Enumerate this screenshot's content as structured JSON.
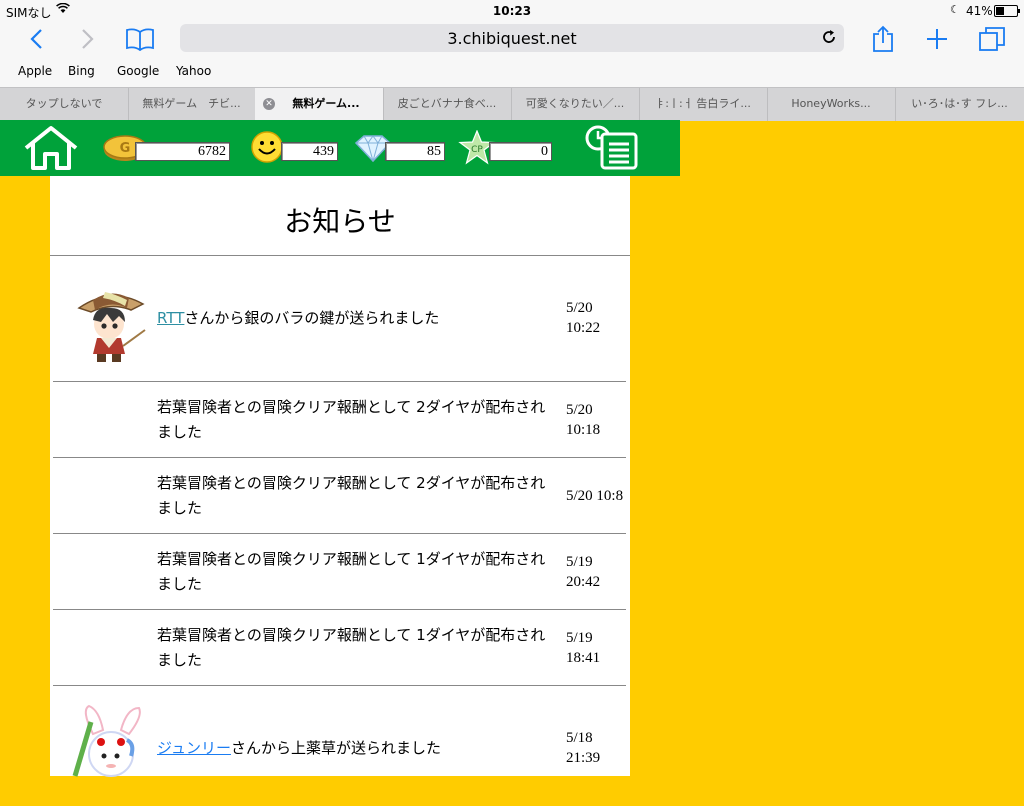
{
  "status_bar": {
    "carrier": "SIMなし",
    "time": "10:23",
    "battery": "41%",
    "battery_level": 0.41
  },
  "browser": {
    "url": "3.chibiquest.net",
    "favorites": [
      "Apple",
      "Bing",
      "Google",
      "Yahoo"
    ],
    "tabs": [
      {
        "label": "タップしないで",
        "active": false
      },
      {
        "label": "無料ゲーム　チビ...",
        "active": false
      },
      {
        "label": "無料ゲーム...",
        "active": true
      },
      {
        "label": "皮ごとバナナ食べ...",
        "active": false
      },
      {
        "label": "可愛くなりたい／...",
        "active": false
      },
      {
        "label": "ㅑ:ㅣ:ㅓ 告白ライ...",
        "active": false
      },
      {
        "label": "HoneyWorks...",
        "active": false
      },
      {
        "label": "い･ろ･は･す フレ...",
        "active": false
      }
    ]
  },
  "game": {
    "stats": {
      "gold": "6782",
      "smile": "439",
      "diamond": "85",
      "cp": "0",
      "gold_coin_letter": "G",
      "cp_badge_text": "CP"
    },
    "notice_title": "お知らせ",
    "notices": [
      {
        "link": "RTT",
        "text": "さんから銀のバラの鍵が送られました",
        "date": "5/20",
        "time": "10:22",
        "avatar": "adventurer-avatar"
      },
      {
        "text": "若葉冒険者との冒険クリア報酬として 2ダイヤが配布されました",
        "date": "5/20",
        "time": "10:18"
      },
      {
        "text": "若葉冒険者との冒険クリア報酬として 2ダイヤが配布されました",
        "date": "5/20 10:8"
      },
      {
        "text": "若葉冒険者との冒険クリア報酬として 1ダイヤが配布されました",
        "date": "5/19",
        "time": "20:42"
      },
      {
        "text": "若葉冒険者との冒険クリア報酬として 1ダイヤが配布されました",
        "date": "5/19",
        "time": "18:41"
      },
      {
        "link": "ジュンリー",
        "text": "さんから上薬草が送られました",
        "date": "5/18",
        "time": "21:39",
        "avatar": "bunny-avatar"
      }
    ]
  }
}
